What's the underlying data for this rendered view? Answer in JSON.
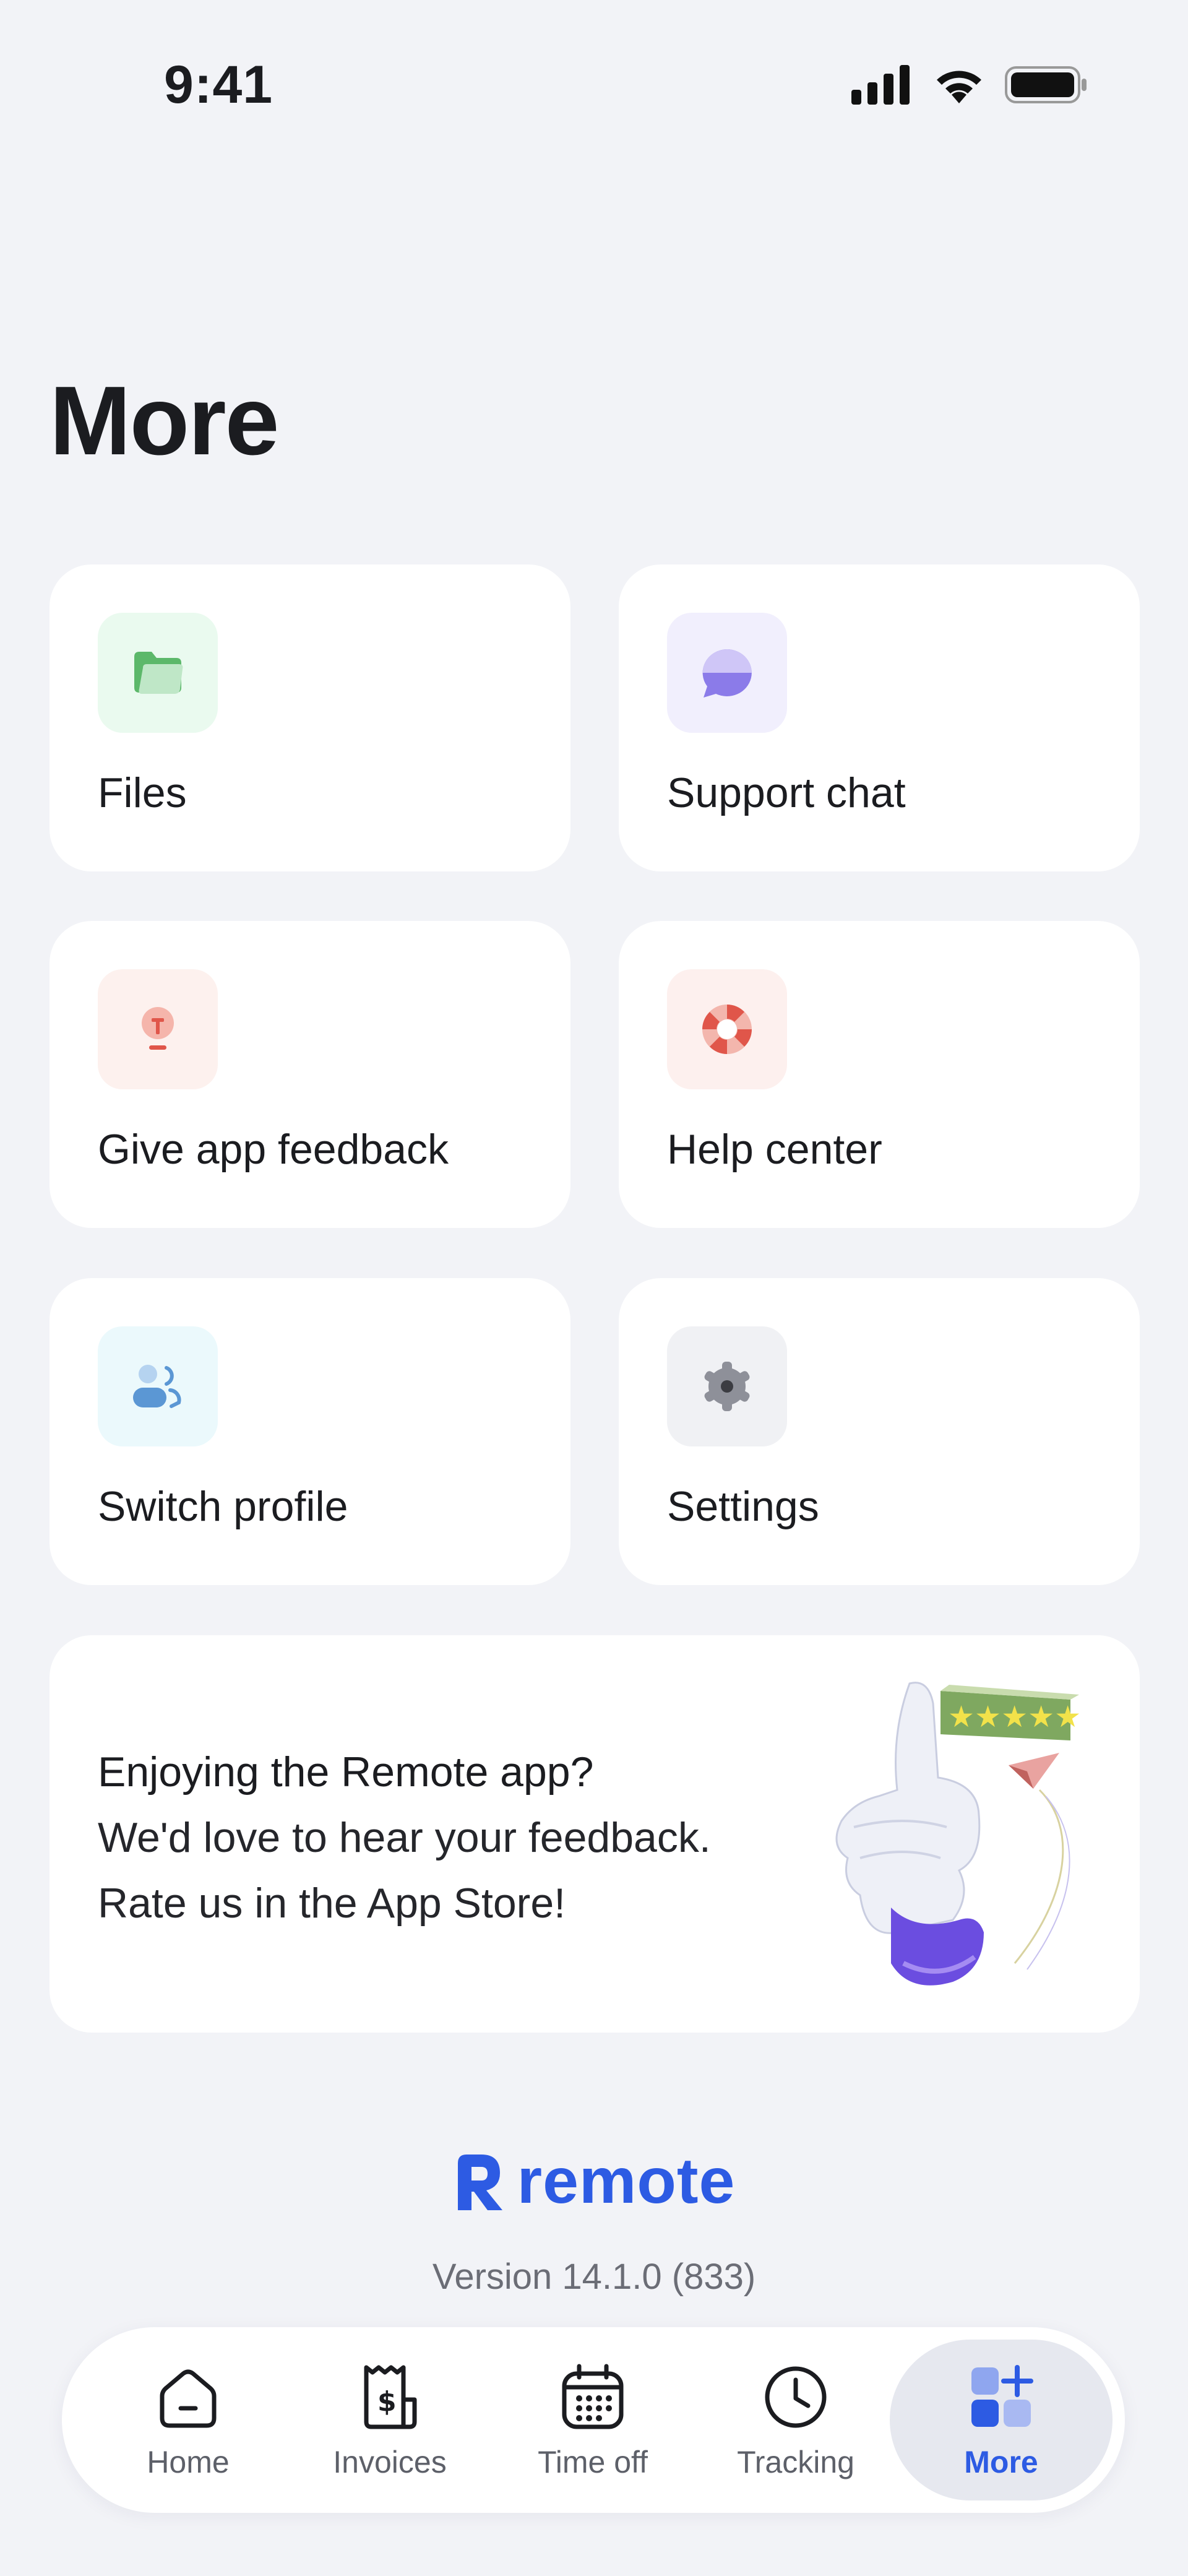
{
  "status_bar": {
    "time": "9:41",
    "icons": [
      "signal-icon",
      "wifi-icon",
      "battery-icon"
    ]
  },
  "page": {
    "title": "More"
  },
  "menu_cards": [
    {
      "label": "Files",
      "icon": "folder-icon",
      "accent": "#5cb86a",
      "tile_bg": "#eafaef"
    },
    {
      "label": "Support chat",
      "icon": "chat-bubble-icon",
      "accent": "#8b7be9",
      "tile_bg": "#f1effd"
    },
    {
      "label": "Give app feedback",
      "icon": "lightbulb-icon",
      "accent": "#e0564a",
      "tile_bg": "#fdf1ee"
    },
    {
      "label": "Help center",
      "icon": "lifebuoy-icon",
      "accent": "#e0564a",
      "tile_bg": "#fdf0ee"
    },
    {
      "label": "Switch profile",
      "icon": "switch-users-icon",
      "accent": "#5b97d4",
      "tile_bg": "#ebf9fc"
    },
    {
      "label": "Settings",
      "icon": "gear-icon",
      "accent": "#8e9099",
      "tile_bg": "#f0f1f4"
    }
  ],
  "rating_banner": {
    "heading": "Enjoying the Remote app?",
    "line1": "We'd love to hear your feedback.",
    "line2": "Rate us in the App Store!",
    "stars": "★★★★★",
    "illustration": "thumbs-up-illustration"
  },
  "brand": {
    "name": "remote",
    "color": "#2d5be3"
  },
  "version": "Version 14.1.0 (833)",
  "tab_bar": {
    "active": "More",
    "tabs": [
      {
        "label": "Home",
        "icon": "home-icon"
      },
      {
        "label": "Invoices",
        "icon": "invoice-icon"
      },
      {
        "label": "Time off",
        "icon": "calendar-icon"
      },
      {
        "label": "Tracking",
        "icon": "clock-icon"
      },
      {
        "label": "More",
        "icon": "more-grid-icon"
      }
    ]
  }
}
